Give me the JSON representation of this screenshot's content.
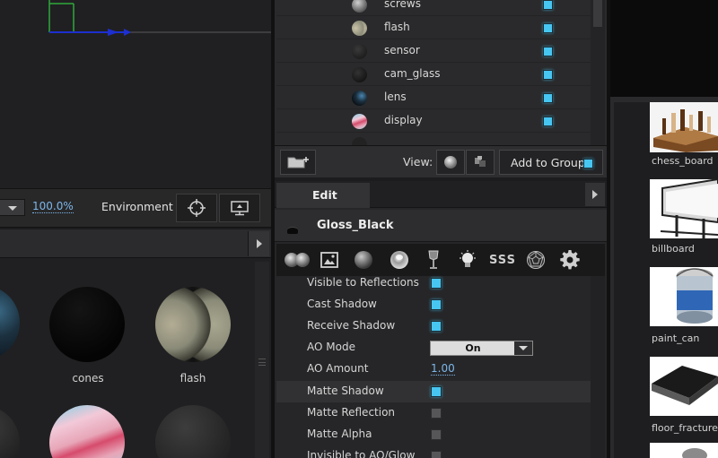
{
  "viewport": {
    "zoom": "100.0%",
    "environment_label": "Environment"
  },
  "material_library": {
    "materials": [
      {
        "label": "",
        "color": "#1c3140"
      },
      {
        "label": "cones",
        "color": "#050505"
      },
      {
        "label": "flash",
        "color": "#8a8a78"
      },
      {
        "label": "",
        "color": "#2a2a2a"
      },
      {
        "label": "",
        "color": "#e7a6b8"
      },
      {
        "label": "",
        "color": "#2b2b2b"
      }
    ]
  },
  "scene_tree": {
    "rows": [
      {
        "name": "screws",
        "visible": true
      },
      {
        "name": "flash",
        "visible": true
      },
      {
        "name": "sensor",
        "visible": true
      },
      {
        "name": "cam_glass",
        "visible": true
      },
      {
        "name": "lens",
        "visible": true
      },
      {
        "name": "display",
        "visible": true
      }
    ],
    "footer": {
      "view_label": "View:",
      "add_to_group_label": "Add to Group"
    }
  },
  "edit_panel": {
    "tab_label": "Edit",
    "material_name": "Gloss_Black",
    "icons": [
      "spheres-icon",
      "image-icon",
      "sphere-icon",
      "chrome-sphere-icon",
      "glass-icon",
      "light-bulb-icon",
      "sss-icon",
      "wireframe-sphere-icon",
      "gear-icon"
    ],
    "sss_text": "SSS",
    "properties": [
      {
        "label": "Visible to Reflections",
        "type": "checkbox",
        "checked": true
      },
      {
        "label": "Cast Shadow",
        "type": "checkbox",
        "checked": true
      },
      {
        "label": "Receive Shadow",
        "type": "checkbox",
        "checked": true
      },
      {
        "label": "AO Mode",
        "type": "select",
        "value": "On"
      },
      {
        "label": "AO Amount",
        "type": "number",
        "value": "1.00"
      },
      {
        "label": "Matte Shadow",
        "type": "checkbox",
        "checked": true
      },
      {
        "label": "Matte Reflection",
        "type": "checkbox",
        "checked": false
      },
      {
        "label": "Matte Alpha",
        "type": "checkbox",
        "checked": false
      },
      {
        "label": "Invisible to AO/Glow",
        "type": "checkbox",
        "checked": false
      }
    ]
  },
  "model_library": {
    "models": [
      {
        "label": "chess_board"
      },
      {
        "label": "billboard"
      },
      {
        "label": "paint_can"
      },
      {
        "label": "floor_fracture"
      }
    ]
  },
  "colors": {
    "accent_check": "#47c6f2",
    "link_value": "#7db7ea",
    "panel_bg": "#262628"
  }
}
